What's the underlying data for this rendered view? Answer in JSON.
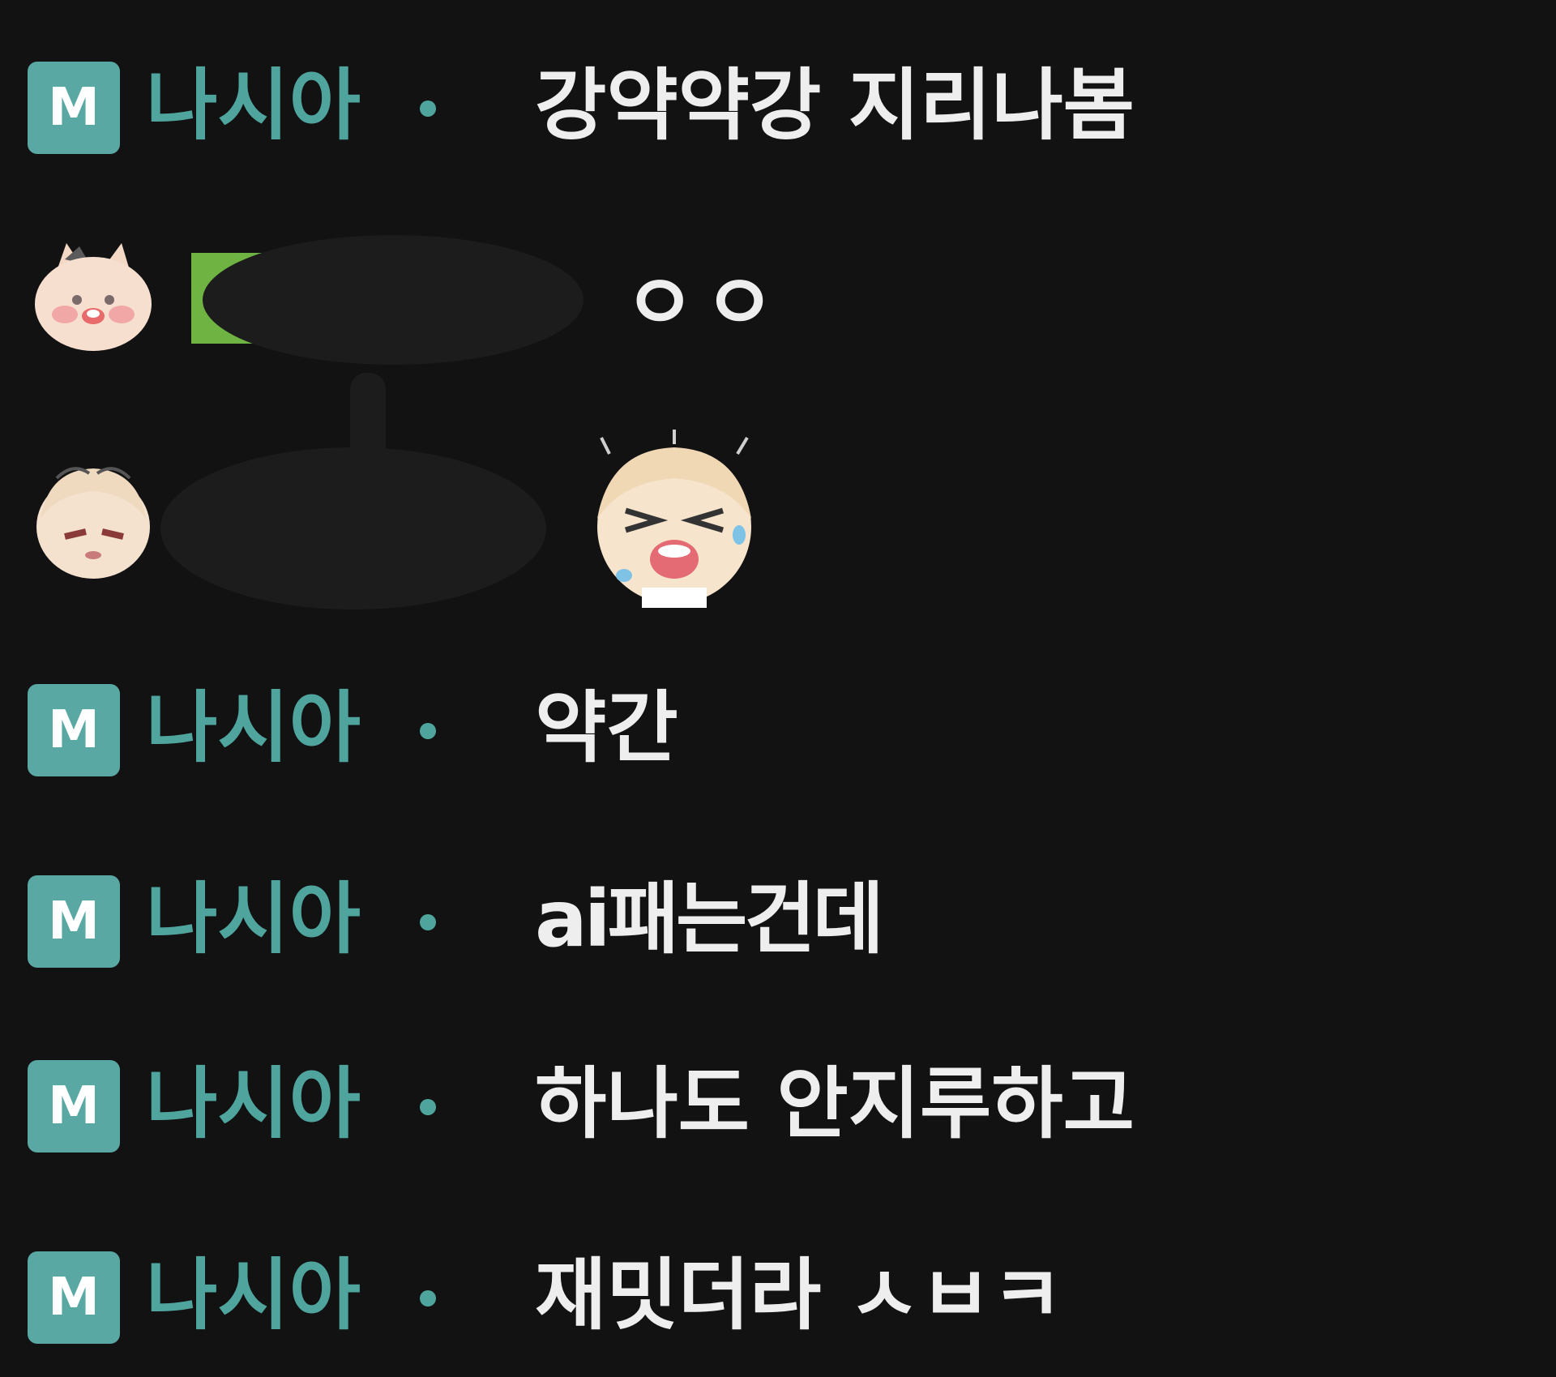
{
  "colors": {
    "background": "#121213",
    "nickname": "#4fa59e",
    "badge": "#5aa8a3",
    "message": "#eeeeee",
    "tag_green": "#6fb343"
  },
  "messages": [
    {
      "badge": "M",
      "nickname": "나시아",
      "text": "강약약강 지리나봄"
    },
    {
      "avatar": "cat-emoticon-avatar",
      "nickname_redacted": true,
      "text": "ㅇㅇ"
    },
    {
      "avatar": "anime-girl-avatar",
      "nickname_redacted": true,
      "sticker": "crying-girl-sticker"
    },
    {
      "badge": "M",
      "nickname": "나시아",
      "text": "약간"
    },
    {
      "badge": "M",
      "nickname": "나시아",
      "text": "ai패는건데"
    },
    {
      "badge": "M",
      "nickname": "나시아",
      "text": "하나도 안지루하고"
    },
    {
      "badge": "M",
      "nickname": "나시아",
      "text": "재밋더라 ㅅㅂㅋ"
    }
  ]
}
